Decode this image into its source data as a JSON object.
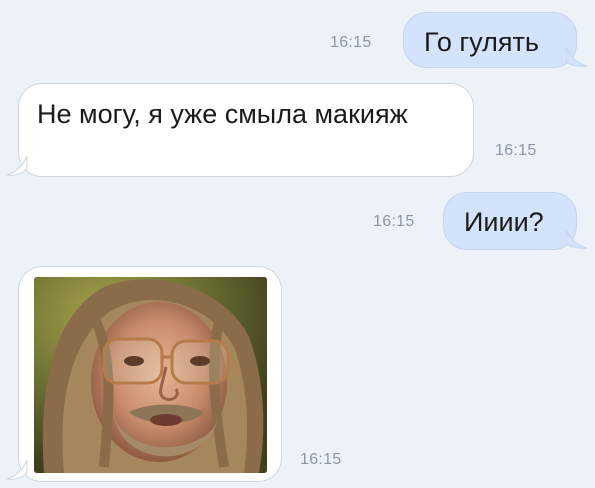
{
  "messages": [
    {
      "direction": "outgoing",
      "text": "Го гулять",
      "time": "16:15"
    },
    {
      "direction": "incoming",
      "text": "Не могу, я уже смыла макияж",
      "time": "16:15"
    },
    {
      "direction": "outgoing",
      "text": "Ииии?",
      "time": "16:15"
    },
    {
      "direction": "incoming",
      "type": "photo",
      "time": "16:15"
    }
  ],
  "colors": {
    "background": "#edf1f8",
    "outgoing_bubble": "#d2e3fb",
    "incoming_bubble": "#ffffff",
    "timestamp": "#8c97a6"
  }
}
